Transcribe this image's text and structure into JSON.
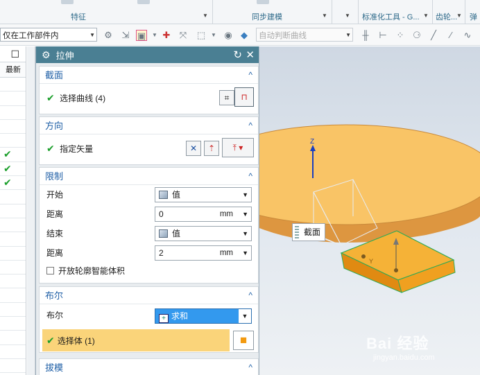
{
  "ribbon": {
    "groups": [
      "特征",
      "同步建模",
      "标准化工具 - G...",
      "齿轮...",
      "弹"
    ]
  },
  "toolbar": {
    "scope_select": "仅在工作部件内",
    "curve_rule_select": "自动判断曲线"
  },
  "resource_list": {
    "header_label": "最新",
    "checked_rows": [
      5,
      6,
      7
    ]
  },
  "dialog": {
    "title": "拉伸",
    "sections": {
      "section_curve": {
        "title": "截面",
        "select_curve_label": "选择曲线 (4)"
      },
      "direction": {
        "title": "方向",
        "vector_label": "指定矢量"
      },
      "limits": {
        "title": "限制",
        "start_label": "开始",
        "start_value": "值",
        "start_distance_label": "距离",
        "start_distance_value": "0",
        "start_unit": "mm",
        "end_label": "结束",
        "end_value": "值",
        "end_distance_label": "距离",
        "end_distance_value": "2",
        "end_unit": "mm",
        "open_profile_label": "开放轮廓智能体积"
      },
      "boolean": {
        "title": "布尔",
        "boolean_label": "布尔",
        "boolean_value": "求和",
        "select_body_label": "选择体 (1)"
      },
      "draft": {
        "title": "拔模"
      }
    }
  },
  "viewport": {
    "tooltip": "截面",
    "axis_z": "Z",
    "axis_y": "Y",
    "cylinder_top_color": "#f8c05c",
    "cylinder_side_color": "#e29a3e",
    "extrude_color": "#f3a71e"
  },
  "watermark": {
    "brand": "Bai 经验",
    "url": "jingyan.baidu.com"
  }
}
